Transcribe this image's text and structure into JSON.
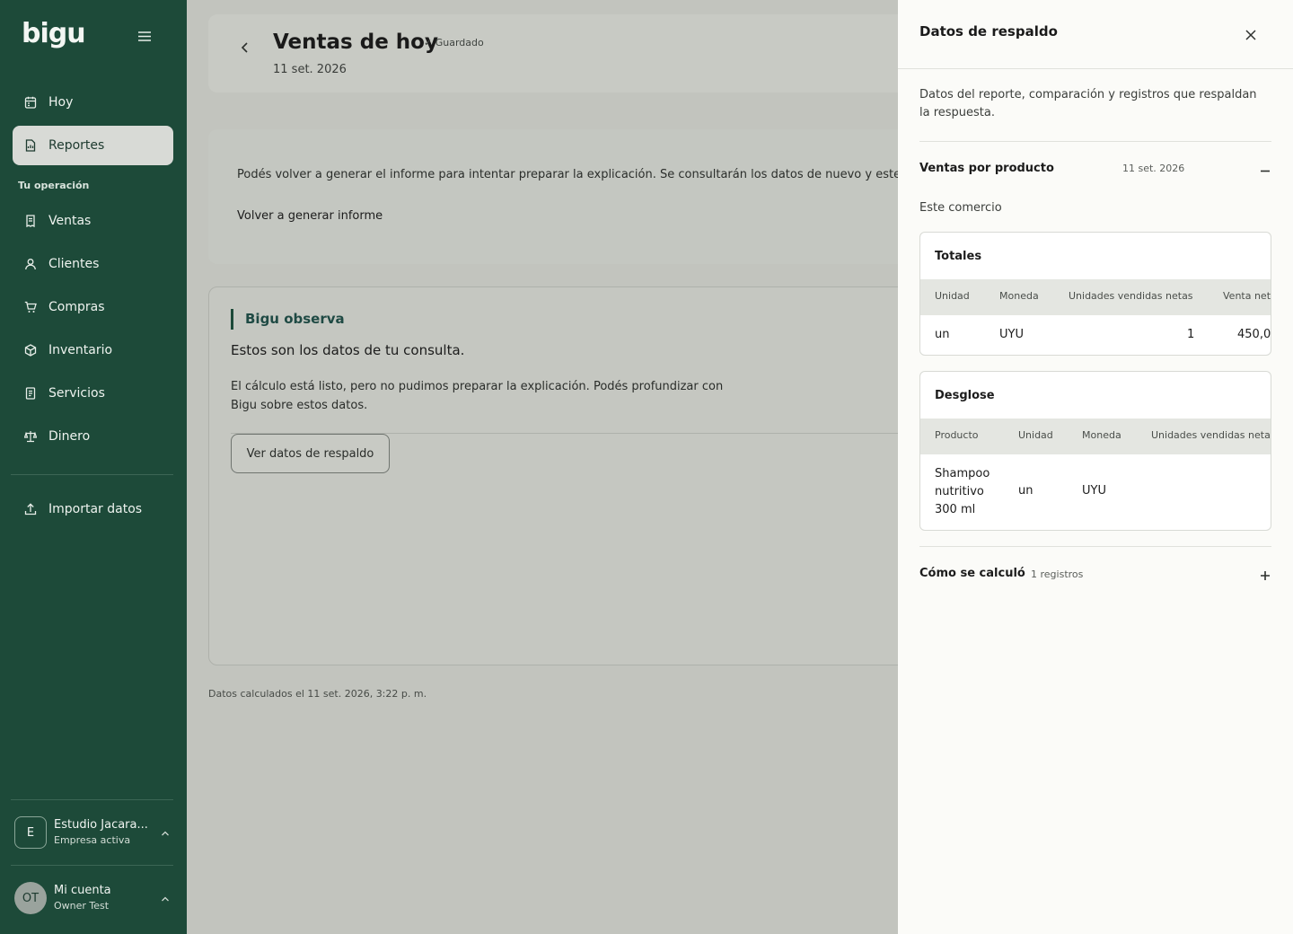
{
  "sidebar": {
    "logo": "bigu",
    "items_top": [
      {
        "label": "Hoy",
        "icon": "calendar-icon"
      },
      {
        "label": "Reportes",
        "icon": "report-icon",
        "active": true
      }
    ],
    "section_label": "Tu operación",
    "items_ops": [
      {
        "label": "Ventas",
        "icon": "receipt-icon"
      },
      {
        "label": "Clientes",
        "icon": "user-icon"
      },
      {
        "label": "Compras",
        "icon": "cart-icon"
      },
      {
        "label": "Inventario",
        "icon": "box-icon"
      },
      {
        "label": "Servicios",
        "icon": "document-icon"
      },
      {
        "label": "Dinero",
        "icon": "scale-icon"
      }
    ],
    "import_label": "Importar datos",
    "company": {
      "initial": "E",
      "name": "Estudio Jacara...",
      "status": "Empresa activa"
    },
    "account": {
      "initials": "OT",
      "title": "Mi cuenta",
      "user": "Owner Test"
    }
  },
  "header": {
    "title": "Ventas de hoy",
    "saved_label": "Guardado",
    "date": "11 set. 2026"
  },
  "regen": {
    "message": "Podés volver a generar el informe para intentar preparar la explicación. Se consultarán los datos de nuevo y este res",
    "button": "Volver a generar informe"
  },
  "observation": {
    "title": "Bigu observa",
    "lead": "Estos son los datos de tu consulta.",
    "body": "El cálculo está listo, pero no pudimos preparar la explicación. Podés profundizar con Bigu sobre estos datos.",
    "button": "Ver datos de respaldo"
  },
  "footnote": "Datos calculados el 11 set. 2026, 3:22 p. m.",
  "drawer": {
    "title": "Datos de respaldo",
    "intro": "Datos del reporte, comparación y registros que respaldan la respuesta.",
    "section": {
      "title": "Ventas por producto",
      "date": "11 set. 2026"
    },
    "scope": "Este comercio",
    "totals": {
      "title": "Totales",
      "columns": [
        "Unidad",
        "Moneda",
        "Unidades vendidas netas",
        "Venta net"
      ],
      "row": [
        "un",
        "UYU",
        "1",
        "450,0"
      ]
    },
    "breakdown": {
      "title": "Desglose",
      "columns": [
        "Producto",
        "Unidad",
        "Moneda",
        "Unidades vendidas neta"
      ],
      "row": {
        "product_lines": [
          "Shampoo",
          "nutritivo",
          "300 ml"
        ],
        "unit": "un",
        "currency": "UYU"
      }
    },
    "calc": {
      "title": "Cómo se calculó",
      "count": "1 registros"
    }
  },
  "colors": {
    "sidebar": "#1d4a39",
    "overlay_bg": "#c2c4be",
    "drawer": "#fbfbf8"
  }
}
